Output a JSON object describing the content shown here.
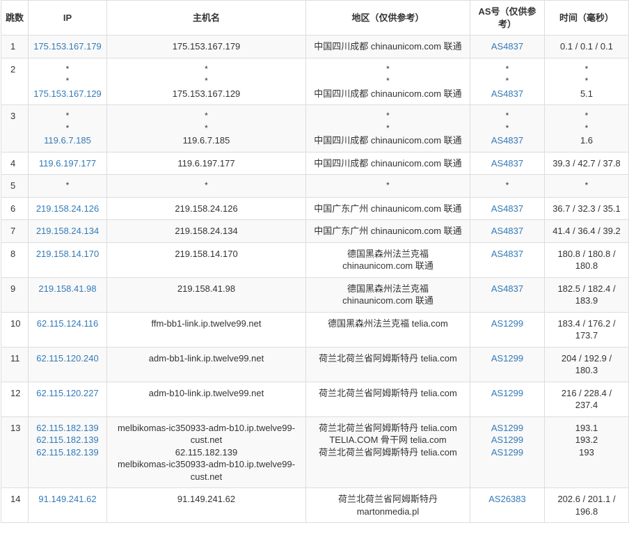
{
  "columns": {
    "hop": "跳数",
    "ip": "IP",
    "host": "主机名",
    "region": "地区（仅供参考）",
    "as": "AS号（仅供参考）",
    "time": "时间（毫秒）"
  },
  "rows": [
    {
      "hop": "1",
      "ip": [
        "175.153.167.179"
      ],
      "host": [
        "175.153.167.179"
      ],
      "region": [
        "中国四川成都 chinaunicom.com 联通"
      ],
      "as": [
        "AS4837"
      ],
      "time": [
        "0.1 / 0.1 / 0.1"
      ]
    },
    {
      "hop": "2",
      "ip": [
        "*",
        "*",
        "175.153.167.129"
      ],
      "host": [
        "*",
        "*",
        "175.153.167.129"
      ],
      "region": [
        "*",
        "*",
        "中国四川成都 chinaunicom.com 联通"
      ],
      "as": [
        "*",
        "*",
        "AS4837"
      ],
      "time": [
        "*",
        "*",
        "5.1"
      ]
    },
    {
      "hop": "3",
      "ip": [
        "*",
        "*",
        "119.6.7.185"
      ],
      "host": [
        "*",
        "*",
        "119.6.7.185"
      ],
      "region": [
        "*",
        "*",
        "中国四川成都 chinaunicom.com 联通"
      ],
      "as": [
        "*",
        "*",
        "AS4837"
      ],
      "time": [
        "*",
        "*",
        "1.6"
      ]
    },
    {
      "hop": "4",
      "ip": [
        "119.6.197.177"
      ],
      "host": [
        "119.6.197.177"
      ],
      "region": [
        "中国四川成都 chinaunicom.com 联通"
      ],
      "as": [
        "AS4837"
      ],
      "time": [
        "39.3 / 42.7 / 37.8"
      ]
    },
    {
      "hop": "5",
      "ip": [
        "*"
      ],
      "host": [
        "*"
      ],
      "region": [
        "*"
      ],
      "as": [
        "*"
      ],
      "time": [
        "*"
      ]
    },
    {
      "hop": "6",
      "ip": [
        "219.158.24.126"
      ],
      "host": [
        "219.158.24.126"
      ],
      "region": [
        "中国广东广州 chinaunicom.com 联通"
      ],
      "as": [
        "AS4837"
      ],
      "time": [
        "36.7 / 32.3 / 35.1"
      ]
    },
    {
      "hop": "7",
      "ip": [
        "219.158.24.134"
      ],
      "host": [
        "219.158.24.134"
      ],
      "region": [
        "中国广东广州 chinaunicom.com 联通"
      ],
      "as": [
        "AS4837"
      ],
      "time": [
        "41.4 / 36.4 / 39.2"
      ]
    },
    {
      "hop": "8",
      "ip": [
        "219.158.14.170"
      ],
      "host": [
        "219.158.14.170"
      ],
      "region": [
        "德国黑森州法兰克福",
        "chinaunicom.com 联通"
      ],
      "as": [
        "AS4837"
      ],
      "time": [
        "180.8 / 180.8 /",
        "180.8"
      ]
    },
    {
      "hop": "9",
      "ip": [
        "219.158.41.98"
      ],
      "host": [
        "219.158.41.98"
      ],
      "region": [
        "德国黑森州法兰克福",
        "chinaunicom.com 联通"
      ],
      "as": [
        "AS4837"
      ],
      "time": [
        "182.5 / 182.4 /",
        "183.9"
      ]
    },
    {
      "hop": "10",
      "ip": [
        "62.115.124.116"
      ],
      "host": [
        "ffm-bb1-link.ip.twelve99.net"
      ],
      "region": [
        "德国黑森州法兰克福 telia.com"
      ],
      "as": [
        "AS1299"
      ],
      "time": [
        "183.4 / 176.2 /",
        "173.7"
      ]
    },
    {
      "hop": "11",
      "ip": [
        "62.115.120.240"
      ],
      "host": [
        "adm-bb1-link.ip.twelve99.net"
      ],
      "region": [
        "荷兰北荷兰省阿姆斯特丹 telia.com"
      ],
      "as": [
        "AS1299"
      ],
      "time": [
        "204 / 192.9 /",
        "180.3"
      ]
    },
    {
      "hop": "12",
      "ip": [
        "62.115.120.227"
      ],
      "host": [
        "adm-b10-link.ip.twelve99.net"
      ],
      "region": [
        "荷兰北荷兰省阿姆斯特丹 telia.com"
      ],
      "as": [
        "AS1299"
      ],
      "time": [
        "216 / 228.4 /",
        "237.4"
      ]
    },
    {
      "hop": "13",
      "ip": [
        "62.115.182.139",
        "62.115.182.139",
        "62.115.182.139"
      ],
      "host": [
        "melbikomas-ic350933-adm-b10.ip.twelve99-",
        "cust.net",
        "62.115.182.139",
        "melbikomas-ic350933-adm-b10.ip.twelve99-",
        "cust.net"
      ],
      "region": [
        "荷兰北荷兰省阿姆斯特丹 telia.com",
        "TELIA.COM 骨干网 telia.com",
        "荷兰北荷兰省阿姆斯特丹 telia.com"
      ],
      "as": [
        "AS1299",
        "AS1299",
        "AS1299"
      ],
      "time": [
        "193.1",
        "193.2",
        "193"
      ]
    },
    {
      "hop": "14",
      "ip": [
        "91.149.241.62"
      ],
      "host": [
        "91.149.241.62"
      ],
      "region": [
        "荷兰北荷兰省阿姆斯特丹",
        "martonmedia.pl"
      ],
      "as": [
        "AS26383"
      ],
      "time": [
        "202.6 / 201.1 /",
        "196.8"
      ]
    }
  ]
}
